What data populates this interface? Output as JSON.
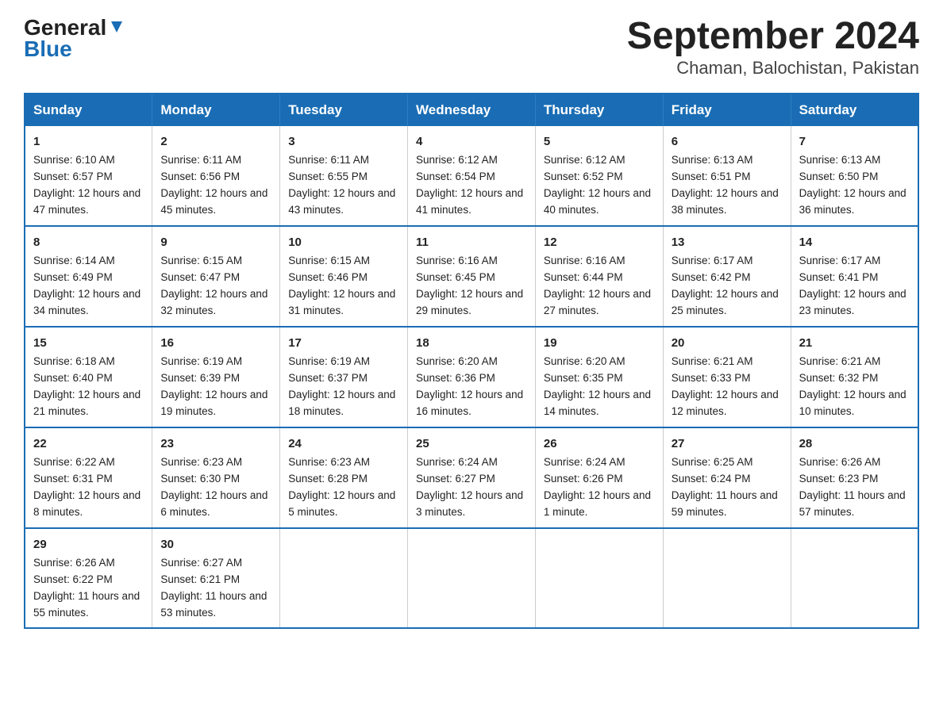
{
  "header": {
    "logo_general": "General",
    "logo_blue": "Blue",
    "title": "September 2024",
    "subtitle": "Chaman, Balochistan, Pakistan"
  },
  "days_header": [
    "Sunday",
    "Monday",
    "Tuesday",
    "Wednesday",
    "Thursday",
    "Friday",
    "Saturday"
  ],
  "weeks": [
    [
      {
        "day": "1",
        "sunrise": "6:10 AM",
        "sunset": "6:57 PM",
        "daylight": "12 hours and 47 minutes."
      },
      {
        "day": "2",
        "sunrise": "6:11 AM",
        "sunset": "6:56 PM",
        "daylight": "12 hours and 45 minutes."
      },
      {
        "day": "3",
        "sunrise": "6:11 AM",
        "sunset": "6:55 PM",
        "daylight": "12 hours and 43 minutes."
      },
      {
        "day": "4",
        "sunrise": "6:12 AM",
        "sunset": "6:54 PM",
        "daylight": "12 hours and 41 minutes."
      },
      {
        "day": "5",
        "sunrise": "6:12 AM",
        "sunset": "6:52 PM",
        "daylight": "12 hours and 40 minutes."
      },
      {
        "day": "6",
        "sunrise": "6:13 AM",
        "sunset": "6:51 PM",
        "daylight": "12 hours and 38 minutes."
      },
      {
        "day": "7",
        "sunrise": "6:13 AM",
        "sunset": "6:50 PM",
        "daylight": "12 hours and 36 minutes."
      }
    ],
    [
      {
        "day": "8",
        "sunrise": "6:14 AM",
        "sunset": "6:49 PM",
        "daylight": "12 hours and 34 minutes."
      },
      {
        "day": "9",
        "sunrise": "6:15 AM",
        "sunset": "6:47 PM",
        "daylight": "12 hours and 32 minutes."
      },
      {
        "day": "10",
        "sunrise": "6:15 AM",
        "sunset": "6:46 PM",
        "daylight": "12 hours and 31 minutes."
      },
      {
        "day": "11",
        "sunrise": "6:16 AM",
        "sunset": "6:45 PM",
        "daylight": "12 hours and 29 minutes."
      },
      {
        "day": "12",
        "sunrise": "6:16 AM",
        "sunset": "6:44 PM",
        "daylight": "12 hours and 27 minutes."
      },
      {
        "day": "13",
        "sunrise": "6:17 AM",
        "sunset": "6:42 PM",
        "daylight": "12 hours and 25 minutes."
      },
      {
        "day": "14",
        "sunrise": "6:17 AM",
        "sunset": "6:41 PM",
        "daylight": "12 hours and 23 minutes."
      }
    ],
    [
      {
        "day": "15",
        "sunrise": "6:18 AM",
        "sunset": "6:40 PM",
        "daylight": "12 hours and 21 minutes."
      },
      {
        "day": "16",
        "sunrise": "6:19 AM",
        "sunset": "6:39 PM",
        "daylight": "12 hours and 19 minutes."
      },
      {
        "day": "17",
        "sunrise": "6:19 AM",
        "sunset": "6:37 PM",
        "daylight": "12 hours and 18 minutes."
      },
      {
        "day": "18",
        "sunrise": "6:20 AM",
        "sunset": "6:36 PM",
        "daylight": "12 hours and 16 minutes."
      },
      {
        "day": "19",
        "sunrise": "6:20 AM",
        "sunset": "6:35 PM",
        "daylight": "12 hours and 14 minutes."
      },
      {
        "day": "20",
        "sunrise": "6:21 AM",
        "sunset": "6:33 PM",
        "daylight": "12 hours and 12 minutes."
      },
      {
        "day": "21",
        "sunrise": "6:21 AM",
        "sunset": "6:32 PM",
        "daylight": "12 hours and 10 minutes."
      }
    ],
    [
      {
        "day": "22",
        "sunrise": "6:22 AM",
        "sunset": "6:31 PM",
        "daylight": "12 hours and 8 minutes."
      },
      {
        "day": "23",
        "sunrise": "6:23 AM",
        "sunset": "6:30 PM",
        "daylight": "12 hours and 6 minutes."
      },
      {
        "day": "24",
        "sunrise": "6:23 AM",
        "sunset": "6:28 PM",
        "daylight": "12 hours and 5 minutes."
      },
      {
        "day": "25",
        "sunrise": "6:24 AM",
        "sunset": "6:27 PM",
        "daylight": "12 hours and 3 minutes."
      },
      {
        "day": "26",
        "sunrise": "6:24 AM",
        "sunset": "6:26 PM",
        "daylight": "12 hours and 1 minute."
      },
      {
        "day": "27",
        "sunrise": "6:25 AM",
        "sunset": "6:24 PM",
        "daylight": "11 hours and 59 minutes."
      },
      {
        "day": "28",
        "sunrise": "6:26 AM",
        "sunset": "6:23 PM",
        "daylight": "11 hours and 57 minutes."
      }
    ],
    [
      {
        "day": "29",
        "sunrise": "6:26 AM",
        "sunset": "6:22 PM",
        "daylight": "11 hours and 55 minutes."
      },
      {
        "day": "30",
        "sunrise": "6:27 AM",
        "sunset": "6:21 PM",
        "daylight": "11 hours and 53 minutes."
      },
      {
        "day": "",
        "sunrise": "",
        "sunset": "",
        "daylight": ""
      },
      {
        "day": "",
        "sunrise": "",
        "sunset": "",
        "daylight": ""
      },
      {
        "day": "",
        "sunrise": "",
        "sunset": "",
        "daylight": ""
      },
      {
        "day": "",
        "sunrise": "",
        "sunset": "",
        "daylight": ""
      },
      {
        "day": "",
        "sunrise": "",
        "sunset": "",
        "daylight": ""
      }
    ]
  ],
  "labels": {
    "sunrise_prefix": "Sunrise: ",
    "sunset_prefix": "Sunset: ",
    "daylight_prefix": "Daylight: "
  }
}
